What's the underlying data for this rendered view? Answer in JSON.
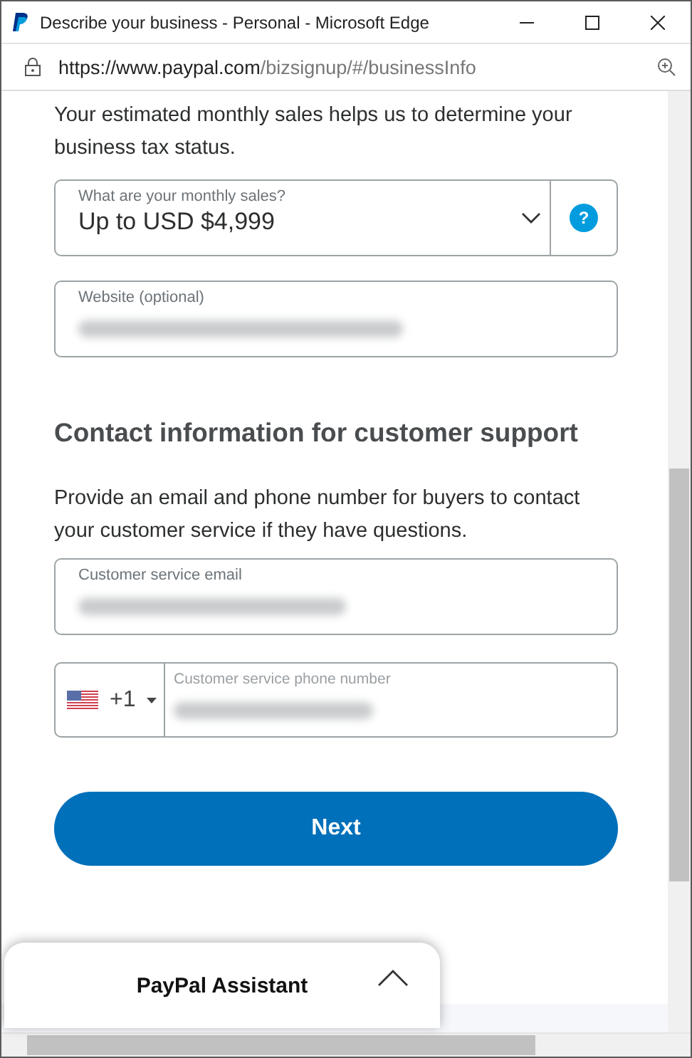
{
  "window": {
    "title": "Describe your business - Personal - Microsoft Edge"
  },
  "address_bar": {
    "url_host": "https://www.paypal.com",
    "url_path": "/bizsignup/#/businessInfo"
  },
  "sales_note": "Your estimated monthly sales helps us to determine your business tax status.",
  "sales_select": {
    "label": "What are your monthly sales?",
    "value": "Up to USD $4,999",
    "help": "?"
  },
  "website_field": {
    "label": "Website (optional)"
  },
  "contact_heading": "Contact information for customer support",
  "contact_note": "Provide an email and phone number for buyers to contact your customer service if they have questions.",
  "email_field": {
    "label": "Customer service email"
  },
  "phone_field": {
    "country_code": "+1",
    "label": "Customer service phone number"
  },
  "next_button": "Next",
  "assistant": {
    "title": "PayPal Assistant",
    "expanded": false
  }
}
